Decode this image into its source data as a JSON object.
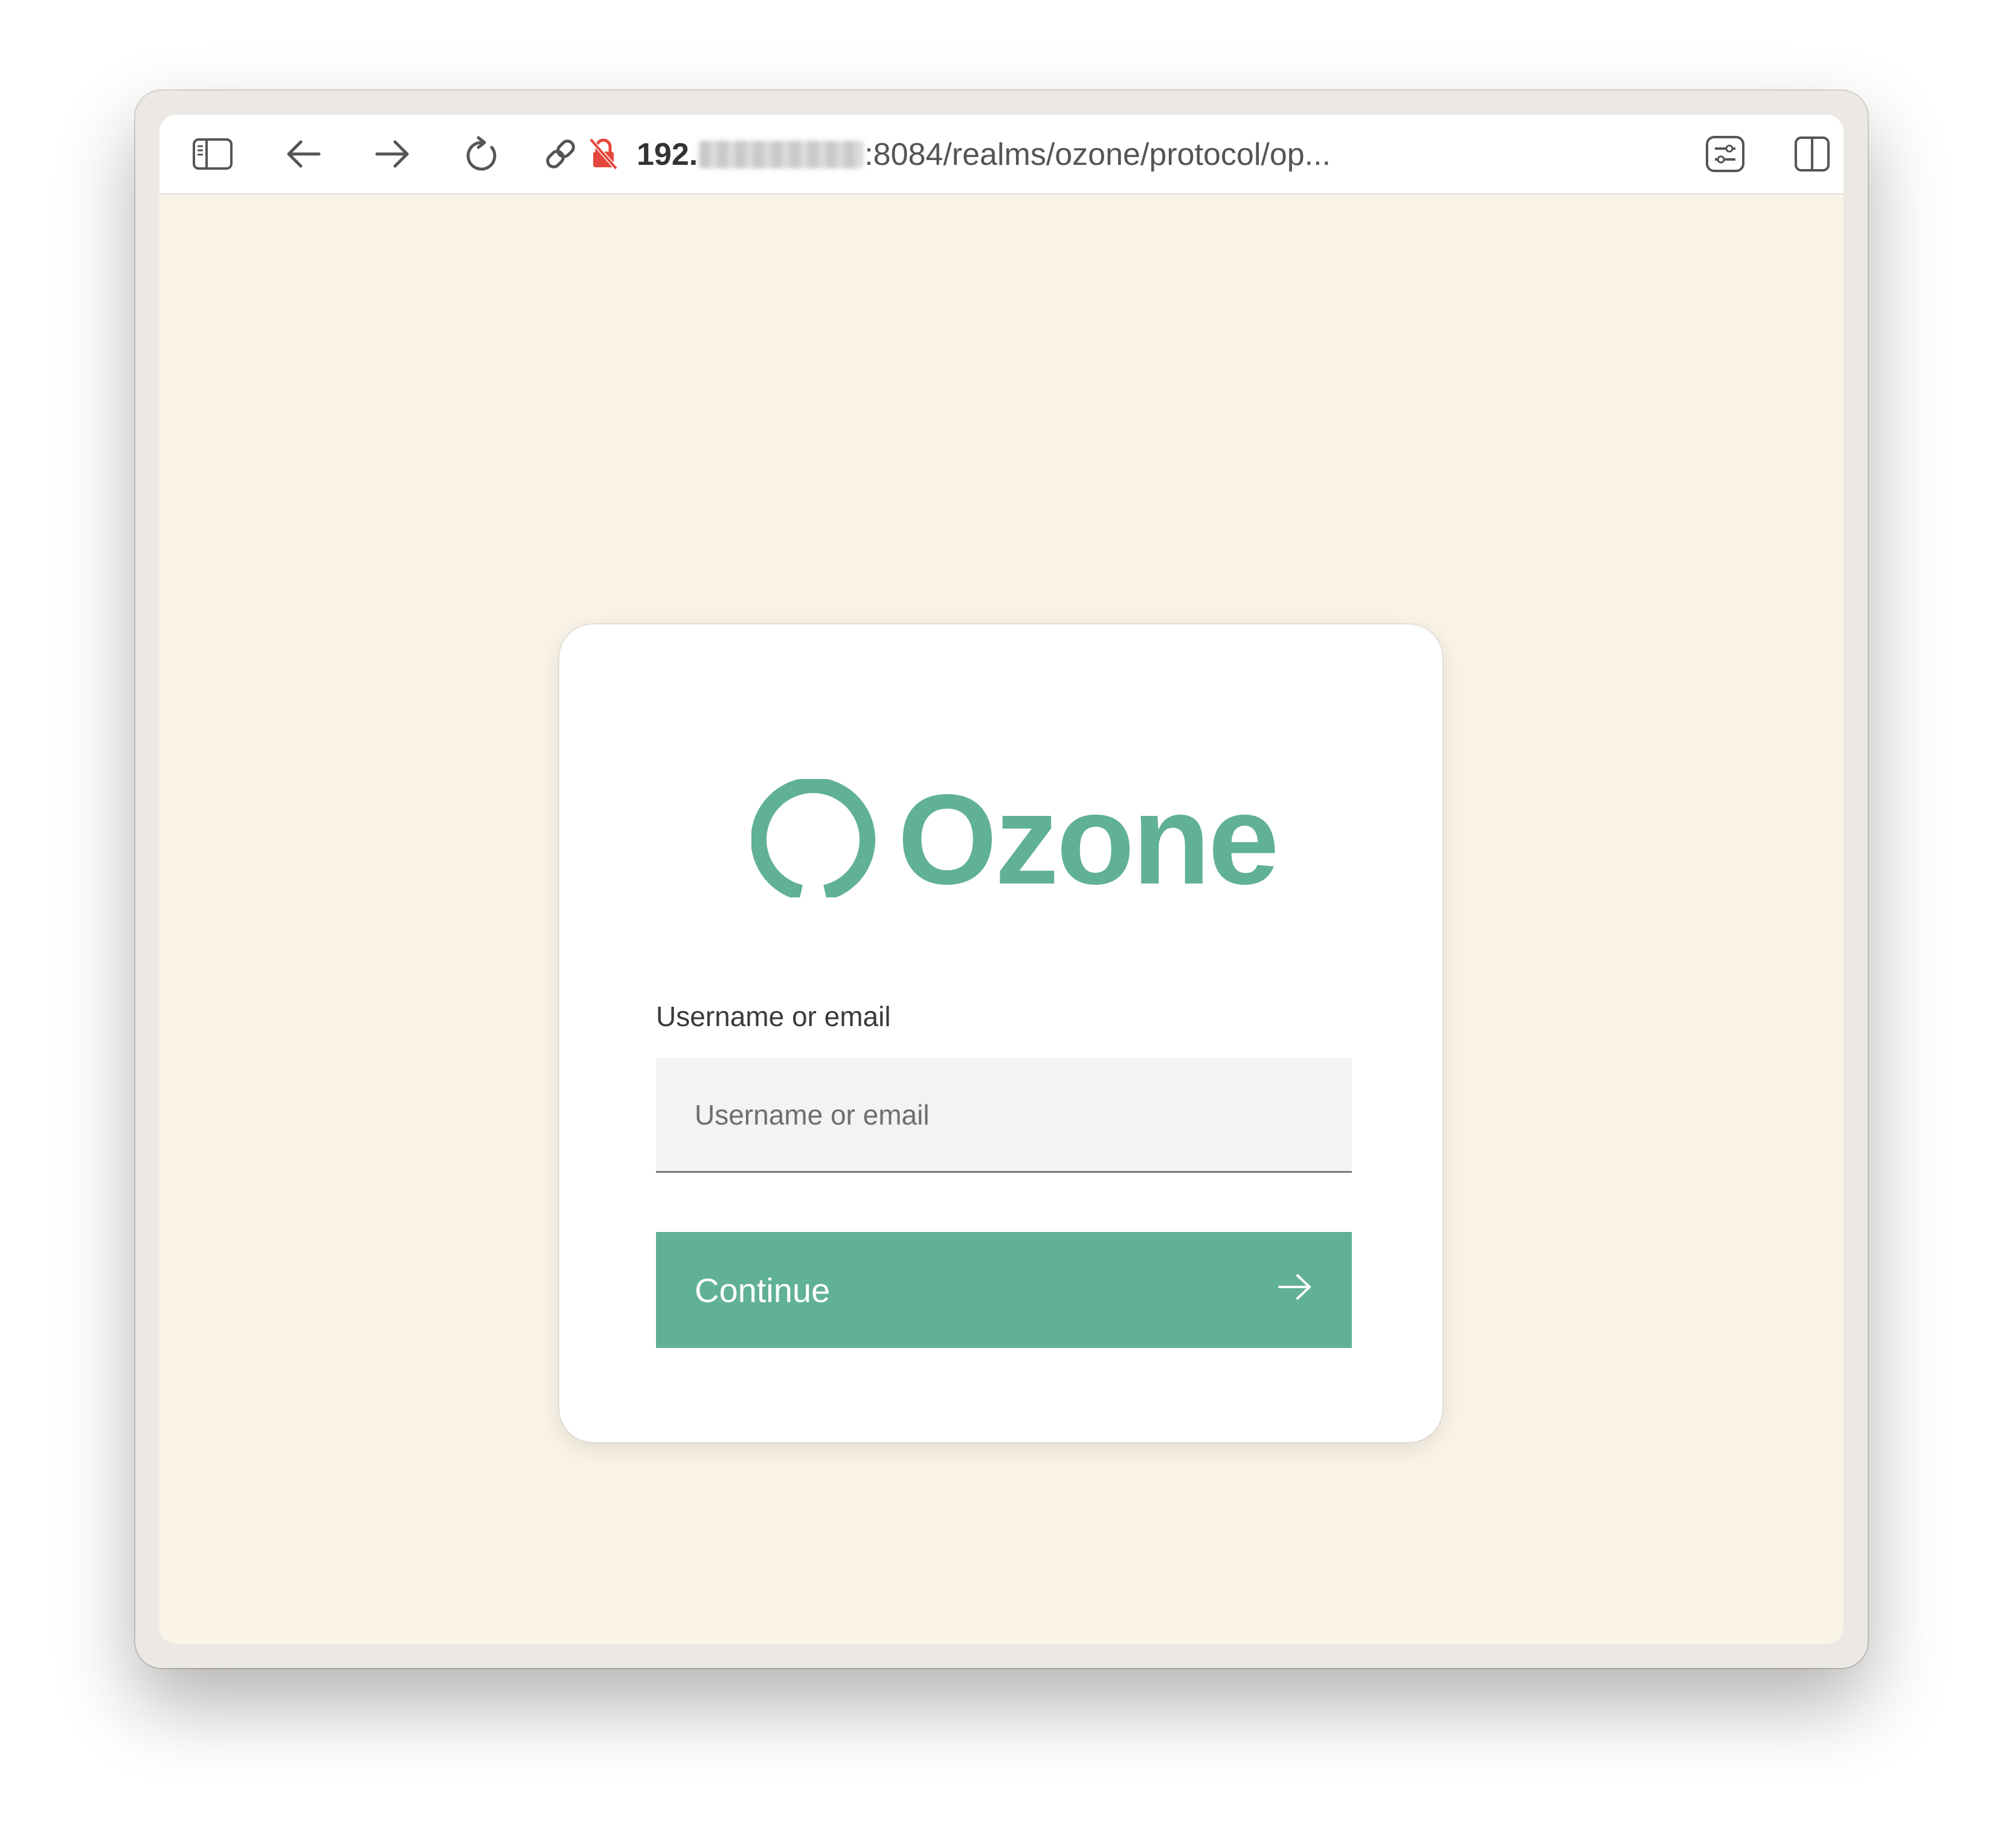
{
  "browser": {
    "url_prefix": "192.",
    "url_suffix": ":8084/realms/ozone/protocol/op..."
  },
  "icons": {
    "sidebar": "sidebar-icon",
    "back": "arrow-left-icon",
    "forward": "arrow-right-icon",
    "reload": "reload-icon",
    "link": "link-icon",
    "insecure": "insecure-lock-icon",
    "settings": "sliders-icon",
    "split": "split-view-icon",
    "logo": "ozone-ring-icon",
    "continue_arrow": "arrow-right-icon"
  },
  "colors": {
    "brand": "#61b195",
    "page_bg": "#faf3e7",
    "insecure": "#e5463b"
  },
  "login": {
    "brand_name": "Ozone",
    "field_label": "Username or email",
    "field_placeholder": "Username or email",
    "field_value": "",
    "continue_label": "Continue"
  }
}
